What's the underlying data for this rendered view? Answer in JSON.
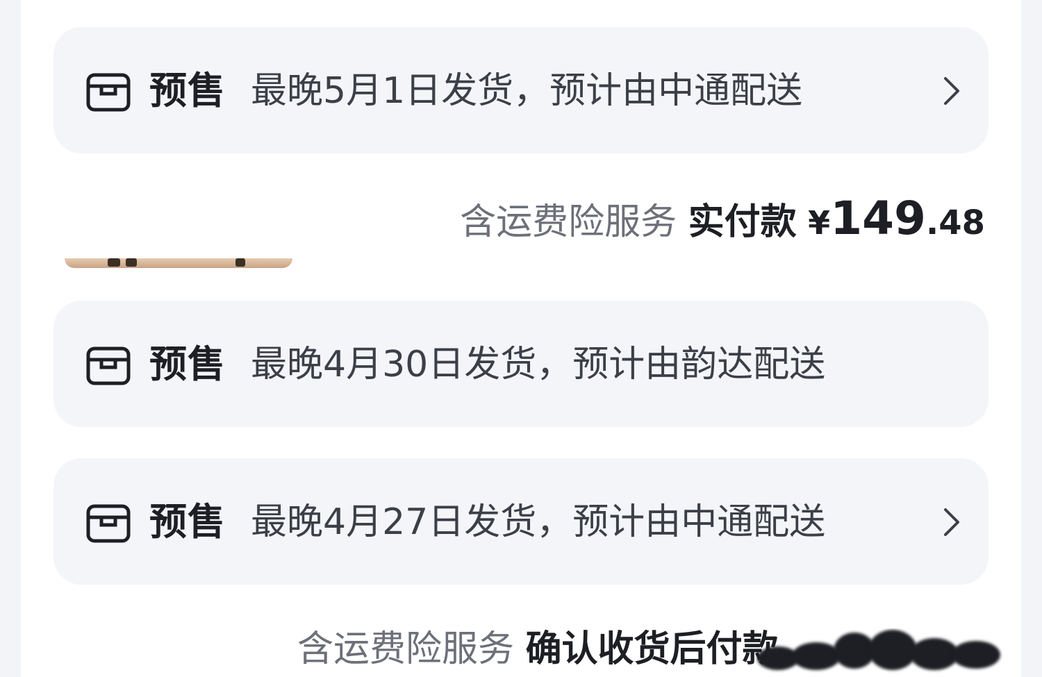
{
  "orders": [
    {
      "tag": "预售",
      "desc": "最晚5月1日发货，预计由中通配送",
      "has_chevron": true,
      "icons": {
        "box": "package-box-icon",
        "chevron": "chevron-right-icon"
      }
    },
    {
      "tag": "预售",
      "desc": "最晚4月30日发货，预计由韵达配送",
      "has_chevron": false,
      "icons": {
        "box": "package-box-icon"
      }
    },
    {
      "tag": "预售",
      "desc": "最晚4月27日发货，预计由中通配送",
      "has_chevron": true,
      "icons": {
        "box": "package-box-icon",
        "chevron": "chevron-right-icon"
      }
    }
  ],
  "summary1": {
    "insurance": "含运费险服务",
    "label": "实付款",
    "currency": "¥",
    "amount_int": "149",
    "amount_dec": ".48"
  },
  "summary2": {
    "insurance": "含运费险服务",
    "label": "确认收货后付款"
  },
  "colors": {
    "page_bg": "#f2f4f8",
    "card_bg": "#ffffff",
    "banner_bg": "#f3f5f9",
    "text_primary": "#1d1f24",
    "text_secondary": "#3c3f47",
    "text_muted": "#6d7079"
  }
}
